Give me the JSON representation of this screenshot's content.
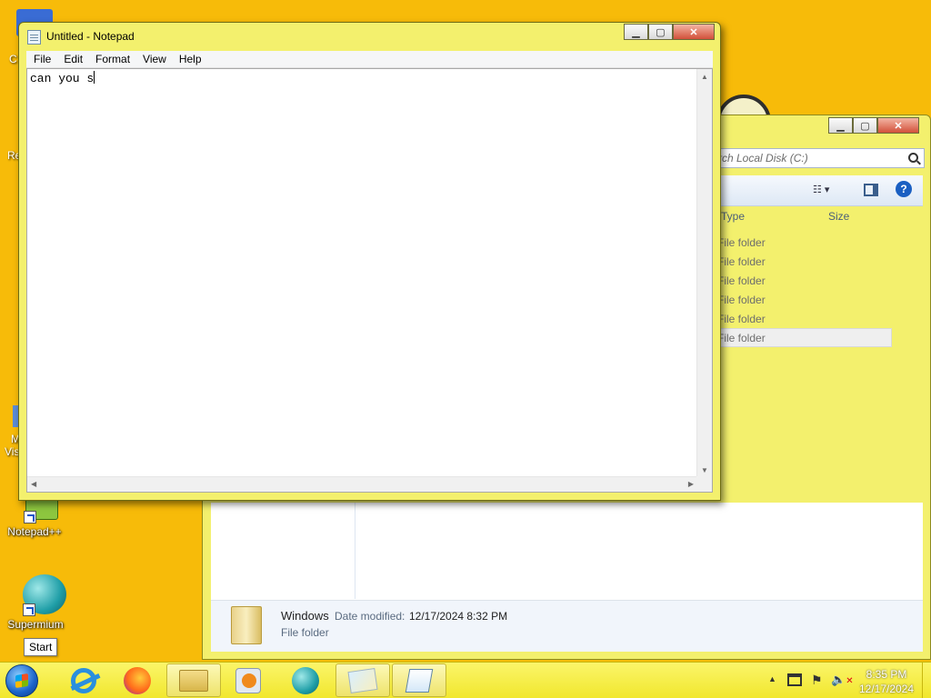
{
  "desktop": {
    "icons": [
      {
        "label": "Notepad++",
        "icon": "notepad-plus-plus-icon"
      },
      {
        "label": "Supermium",
        "icon": "supermium-icon"
      }
    ],
    "partial_labels": [
      "C",
      "Re",
      "M",
      "Vis"
    ],
    "tooltip": "Start"
  },
  "notepad": {
    "title": "Untitled - Notepad",
    "menu": [
      "File",
      "Edit",
      "Format",
      "View",
      "Help"
    ],
    "text": "can you s"
  },
  "explorer": {
    "search_placeholder": "rch Local Disk (C:)",
    "columns": {
      "type": "Type",
      "size": "Size"
    },
    "rows": [
      "File folder",
      "File folder",
      "File folder",
      "File folder",
      "File folder",
      "File folder"
    ],
    "details": {
      "name": "Windows",
      "date_label": "Date modified:",
      "date_value": "12/17/2024 8:32 PM",
      "kind": "File folder"
    }
  },
  "taskbar": {
    "apps": [
      {
        "icon": "internet-explorer-icon"
      },
      {
        "icon": "firefox-icon"
      },
      {
        "icon": "file-explorer-icon"
      },
      {
        "icon": "media-player-icon"
      },
      {
        "icon": "supermium-icon"
      },
      {
        "icon": "folder-window-icon"
      },
      {
        "icon": "notepad-icon"
      }
    ],
    "clock": {
      "time": "8:35 PM",
      "date": "12/17/2024"
    }
  },
  "colors": {
    "desktop_bg": "#f7bb09",
    "window_frame": "#f3f06d",
    "taskbar": "#f1e72d"
  }
}
